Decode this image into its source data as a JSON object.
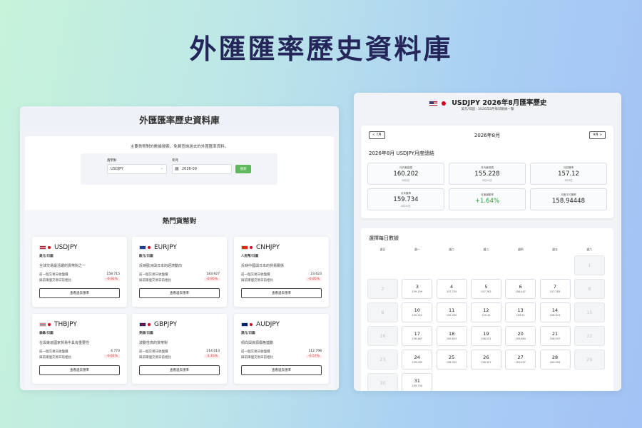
{
  "banner": {
    "title": "外匯匯率歷史資料庫"
  },
  "left_panel": {
    "header_title": "外匯匯率歷史資料庫",
    "search": {
      "description": "主要貨幣對的數據搜索，免費查詢過去的外匯匯率資料。",
      "pair_label": "貨幣對",
      "pair_value": "USDJPY",
      "date_label": "年月",
      "date_value": "2026-09",
      "search_button": "搜索"
    },
    "popular": {
      "title": "熱門貨幣對",
      "cards": [
        {
          "pair": "USDJPY",
          "sub": "美元/日圓",
          "desc": "全球交易最活躍的貨幣對之一",
          "label1": "前一個交易日收盤價",
          "value": "158.715",
          "label2": "與前兩個交易日前相比",
          "change": "-0.92%",
          "button": "查看過去匯率",
          "flag": "us"
        },
        {
          "pair": "EURJPY",
          "sub": "歐元/日圓",
          "desc": "反映歐洲與日本的經濟動向",
          "label1": "前一個交易日收盤價",
          "value": "183.927",
          "label2": "與前兩個交易日前相比",
          "change": "-0.95%",
          "button": "查看過去匯率",
          "flag": "eu"
        },
        {
          "pair": "CNHJPY",
          "sub": "人民幣/日圓",
          "desc": "反映中國與日本的貿易關係",
          "label1": "前一個交易日收盤價",
          "value": "23.623",
          "label2": "與前兩個交易日前相比",
          "change": "-0.85%",
          "button": "查看過去匯率",
          "flag": "cn"
        },
        {
          "pair": "THBJPY",
          "sub": "泰銖/日圓",
          "desc": "在與東協國家貿易中具有重要性",
          "label1": "前一個交易日收盤價",
          "value": "4.773",
          "label2": "與前兩個交易日前相比",
          "change": "-0.62%",
          "button": "查看過去匯率",
          "flag": "th"
        },
        {
          "pair": "GBPJPY",
          "sub": "英鎊/日圓",
          "desc": "波動性高的貨幣對",
          "label1": "前一個交易日收盤價",
          "value": "214.013",
          "label2": "與前兩個交易日前相比",
          "change": "-1.15%",
          "button": "查看過去匯率",
          "flag": "gb"
        },
        {
          "pair": "AUDJPY",
          "sub": "澳元/日圓",
          "desc": "傾向與資源價格連動",
          "label1": "前一個交易日收盤價",
          "value": "112.798",
          "label2": "與前兩個交易日前相比",
          "change": "-0.57%",
          "button": "查看過去匯率",
          "flag": "au"
        }
      ]
    }
  },
  "right_panel": {
    "title": "USDJPY  2026年8月匯率歷史",
    "subtitle": "美元/日圓 · 2026年8月每日數據一覽",
    "summary": {
      "prev_button": "< 7月",
      "next_button": "9月 >",
      "month": "2026年8月",
      "heading": "2026年8月 USDJPY月度總結",
      "stats": [
        {
          "label": "月內最高價",
          "value": "160.202",
          "date": "8月3日"
        },
        {
          "label": "月內最低價",
          "value": "155.228",
          "date": "8月10日"
        },
        {
          "label": "月初匯率",
          "value": "157.12",
          "date": "8月3日"
        },
        {
          "label": "月末匯率",
          "value": "159.734",
          "date": "8月31日"
        },
        {
          "label": "月度變動率",
          "value": "+1.64%",
          "date": ""
        },
        {
          "label": "月度平均匯率",
          "value": "158.94448",
          "date": ""
        }
      ]
    },
    "calendar": {
      "title": "選擇每日數據",
      "weekdays": [
        "週日",
        "週一",
        "週二",
        "週三",
        "週四",
        "週五",
        "週六"
      ],
      "days": [
        {
          "d": "1",
          "r": "",
          "off": true
        },
        {
          "d": "2",
          "r": "",
          "off": true
        },
        {
          "d": "3",
          "r": "159.159",
          "off": false
        },
        {
          "d": "4",
          "r": "157.734",
          "off": false
        },
        {
          "d": "5",
          "r": "157.762",
          "off": false
        },
        {
          "d": "6",
          "r": "158.447",
          "off": false
        },
        {
          "d": "7",
          "r": "157.783",
          "off": false
        },
        {
          "d": "8",
          "r": "",
          "off": true
        },
        {
          "d": "9",
          "r": "",
          "off": true
        },
        {
          "d": "10",
          "r": "155.202",
          "off": false
        },
        {
          "d": "11",
          "r": "155.292",
          "off": false
        },
        {
          "d": "12",
          "r": "155.42",
          "off": false
        },
        {
          "d": "13",
          "r": "159.51",
          "off": false
        },
        {
          "d": "14",
          "r": "158.924",
          "off": false
        },
        {
          "d": "15",
          "r": "",
          "off": true
        },
        {
          "d": "16",
          "r": "",
          "off": true
        },
        {
          "d": "17",
          "r": "156.467",
          "off": false
        },
        {
          "d": "18",
          "r": "159.623",
          "off": false
        },
        {
          "d": "19",
          "r": "158.151",
          "off": false
        },
        {
          "d": "20",
          "r": "159.664",
          "off": false
        },
        {
          "d": "21",
          "r": "158.937",
          "off": false
        },
        {
          "d": "22",
          "r": "",
          "off": true
        },
        {
          "d": "23",
          "r": "",
          "off": true
        },
        {
          "d": "24",
          "r": "159.095",
          "off": false
        },
        {
          "d": "25",
          "r": "158.352",
          "off": false
        },
        {
          "d": "26",
          "r": "158.307",
          "off": false
        },
        {
          "d": "27",
          "r": "159.297",
          "off": false
        },
        {
          "d": "28",
          "r": "160.094",
          "off": false
        },
        {
          "d": "29",
          "r": "",
          "off": true
        },
        {
          "d": "30",
          "r": "",
          "off": true
        },
        {
          "d": "31",
          "r": "159.734",
          "off": false
        }
      ]
    }
  }
}
